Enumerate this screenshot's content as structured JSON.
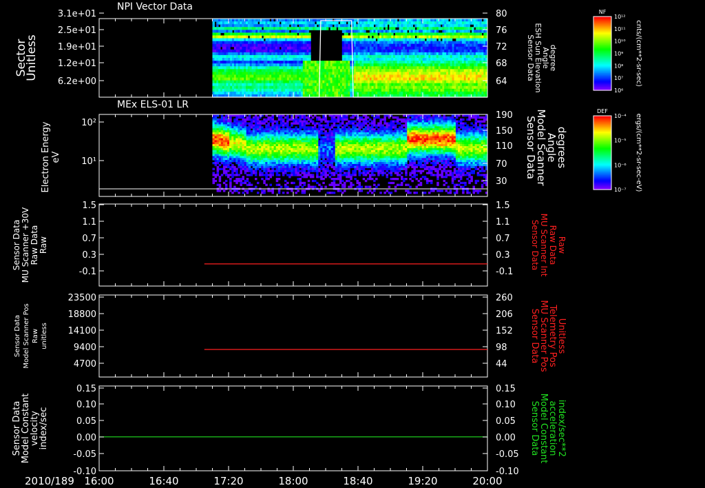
{
  "time_axis": {
    "date_label": "2010/189",
    "ticks": [
      "16:00",
      "16:40",
      "17:20",
      "18:00",
      "18:40",
      "19:20",
      "20:00"
    ]
  },
  "chart_data": [
    {
      "type": "heatmap",
      "title": "NPI Vector Data",
      "ylabel": [
        "Sector",
        "Unitless"
      ],
      "y_ticks": [
        "3.1e+01",
        "2.5e+01",
        "1.9e+01",
        "1.2e+01",
        "6.2e+00"
      ],
      "y2label": [
        "Sensor Data",
        "ESH Sun Elevation",
        "Angle",
        "degree"
      ],
      "y2_ticks": [
        "80",
        "76",
        "72",
        "68",
        "64"
      ],
      "overlay_line": {
        "color": "#ffffff",
        "x": [
          "17:10",
          "18:16",
          "18:17",
          "18:23",
          "18:27",
          "18:36",
          "18:37",
          "20:00"
        ],
        "y": [
          60,
          60,
          79.5,
          79.5,
          79.5,
          79.5,
          60,
          60
        ]
      },
      "colorbar": {
        "label": "NF",
        "unit": "cnts/(cm**2-sr-sec)",
        "ticks": [
          "10¹²",
          "10¹¹",
          "10¹⁰",
          "10⁹",
          "10⁸",
          "10⁷",
          "10⁶"
        ]
      }
    },
    {
      "type": "heatmap",
      "title": "MEx ELS-01 LR",
      "ylabel": [
        "Electron Energy",
        "eV"
      ],
      "y_ticks": [
        "10²",
        "10¹"
      ],
      "y2label": [
        "Sensor Data",
        "Model Scanner",
        "Angle",
        "degrees"
      ],
      "y2_ticks": [
        "190",
        "150",
        "110",
        "70",
        "30"
      ],
      "colorbar": {
        "label": "DEF",
        "unit": "ergs/(cm**2-sr-sec-eV)",
        "ticks": [
          "10⁻⁴",
          "10⁻⁵",
          "10⁻⁶",
          "10⁻⁷"
        ]
      }
    },
    {
      "type": "line",
      "ylabel": [
        "Sensor Data",
        "MU Scanner +30V",
        "Raw Data",
        "Raw"
      ],
      "y_ticks": [
        "1.5",
        "1.1",
        "0.7",
        "0.3",
        "-0.1"
      ],
      "ylim": [
        -0.5,
        1.5
      ],
      "y2label": [
        "Sensor Data",
        "MU Scanner Int",
        "Raw Data",
        "Raw"
      ],
      "y2_ticks": [
        "1.5",
        "1.1",
        "0.7",
        "0.3",
        "-0.1"
      ],
      "series": [
        {
          "color": "#ff2020",
          "x": [
            "17:05",
            "20:00"
          ],
          "y": [
            0.04,
            0.04
          ]
        }
      ]
    },
    {
      "type": "line",
      "ylabel": [
        "Sensor Data",
        "Model Scanner Pos",
        "Raw",
        "unitless"
      ],
      "y_ticks": [
        "23500",
        "18800",
        "14100",
        "9400",
        "4700"
      ],
      "ylim": [
        0,
        23500
      ],
      "y2label": [
        "Sensor Data",
        "MU Scanner Pos",
        "Telemetry Pos",
        "Unitless"
      ],
      "y2_ticks": [
        "260",
        "206",
        "152",
        "98",
        "44"
      ],
      "series": [
        {
          "color": "#ff2020",
          "x": [
            "17:05",
            "20:00"
          ],
          "y": [
            7900,
            7900
          ]
        }
      ]
    },
    {
      "type": "line",
      "ylabel": [
        "Sensor Data",
        "Model Constant",
        "velocity",
        "index/sec"
      ],
      "y_ticks": [
        "0.15",
        "0.10",
        "0.05",
        "0.00",
        "-0.05",
        "-0.10"
      ],
      "ylim": [
        -0.1,
        0.15
      ],
      "y2label": [
        "Sensor Data",
        "Model Constant",
        "acceleration",
        "index/sec**2"
      ],
      "y2_ticks": [
        "0.15",
        "0.10",
        "0.05",
        "0.00",
        "-0.05",
        "-0.10"
      ],
      "series": [
        {
          "color": "#20e020",
          "x": [
            "16:00",
            "20:00"
          ],
          "y": [
            0,
            0
          ]
        }
      ]
    }
  ]
}
